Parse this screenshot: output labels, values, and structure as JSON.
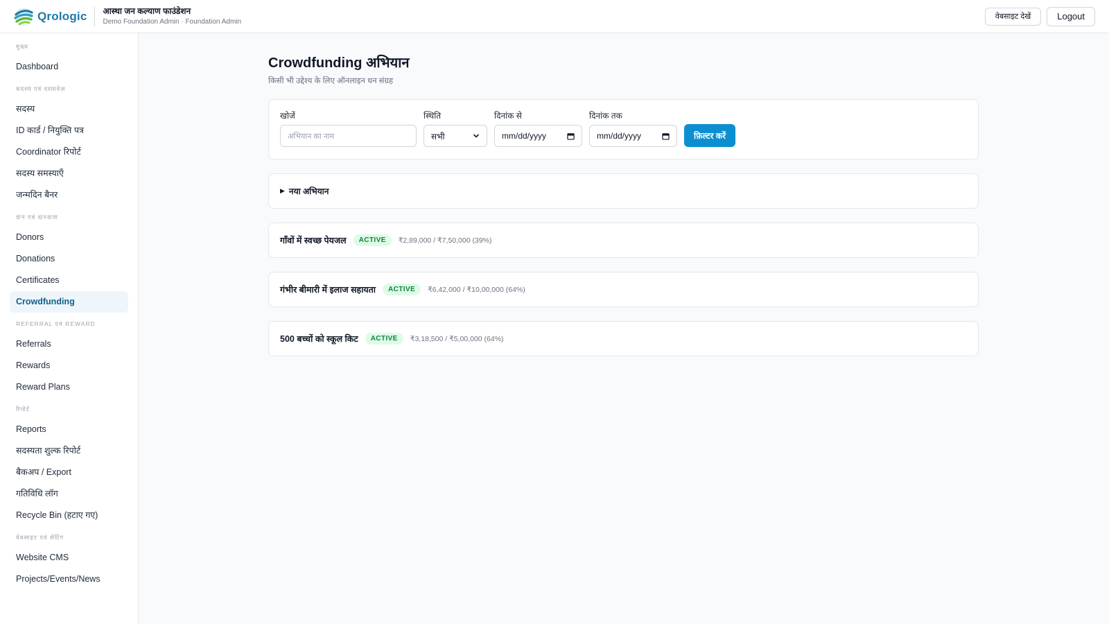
{
  "header": {
    "logo_text": "Qrologic",
    "org_name": "आस्था जन कल्याण फाउंडेशन",
    "org_sub": "Demo Foundation Admin · Foundation Admin",
    "view_site_label": "वेबसाइट देखें",
    "logout_label": "Logout"
  },
  "sidebar": {
    "sections": [
      {
        "heading": "मुख्य",
        "items": [
          "Dashboard"
        ]
      },
      {
        "heading": "सदस्य एवं दस्तावेज़",
        "items": [
          "सदस्य",
          "ID कार्ड / नियुक्ति पत्र",
          "Coordinator रिपोर्ट",
          "सदस्य समस्याएँ",
          "जन्मदिन बैनर"
        ]
      },
      {
        "heading": "दान एवं दानदाता",
        "items": [
          "Donors",
          "Donations",
          "Certificates",
          "Crowdfunding"
        ]
      },
      {
        "heading": "Referral एवं Reward",
        "items": [
          "Referrals",
          "Rewards",
          "Reward Plans"
        ]
      },
      {
        "heading": "रिपोर्ट",
        "items": [
          "Reports",
          "सदस्यता शुल्क रिपोर्ट",
          "बैकअप / Export",
          "गतिविधि लॉग",
          "Recycle Bin (हटाए गए)"
        ]
      },
      {
        "heading": "वेबसाइट एवं सेटिंग",
        "items": [
          "Website CMS",
          "Projects/Events/News"
        ]
      }
    ],
    "active_item": "Crowdfunding"
  },
  "page": {
    "title": "Crowdfunding अभियान",
    "subtitle": "किसी भी उद्देश्य के लिए ऑनलाइन धन संग्रह"
  },
  "filters": {
    "search_label": "खोजें",
    "search_placeholder": "अभियान का नाम",
    "status_label": "स्थिति",
    "status_value": "सभी",
    "date_from_label": "दिनांक से",
    "date_from_value": "mm/dd/yyyy",
    "date_to_label": "दिनांक तक",
    "date_to_value": "mm/dd/yyyy",
    "filter_button": "फ़िल्टर करें"
  },
  "new_campaign_label": "नया अभियान",
  "campaigns": [
    {
      "title": "गाँवों में स्वच्छ पेयजल",
      "status": "ACTIVE",
      "amount": "₹2,89,000 / ₹7,50,000 (39%)"
    },
    {
      "title": "गंभीर बीमारी में इलाज सहायता",
      "status": "ACTIVE",
      "amount": "₹6,42,000 / ₹10,00,000 (64%)"
    },
    {
      "title": "500 बच्चों को स्कूल किट",
      "status": "ACTIVE",
      "amount": "₹3,18,500 / ₹5,00,000 (64%)"
    }
  ],
  "colors": {
    "brand": "#1f7aa8",
    "primary_button": "#0b8fd1",
    "active_badge_bg": "#dcfce7",
    "active_badge_text": "#15803d"
  }
}
